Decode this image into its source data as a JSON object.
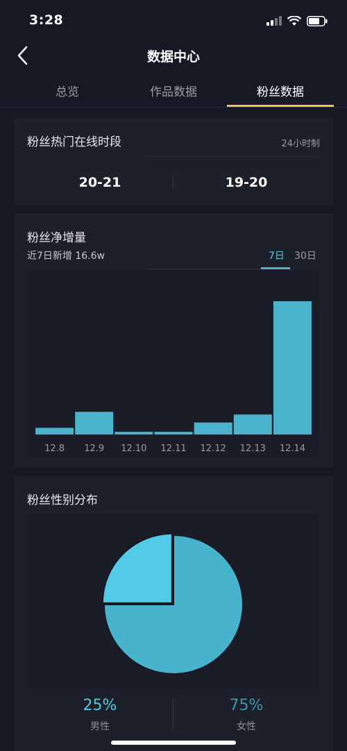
{
  "status": {
    "time": "3:28"
  },
  "nav": {
    "title": "数据中心"
  },
  "tabs": [
    {
      "label": "总览"
    },
    {
      "label": "作品数据"
    },
    {
      "label": "粉丝数据"
    }
  ],
  "active_tab": "粉丝数据",
  "online": {
    "title": "粉丝热门在线时段",
    "hint": "24小时制",
    "slots": [
      "20-21",
      "19-20"
    ]
  },
  "growth": {
    "title": "粉丝净增量",
    "subtitle": "近7日新增 16.6w",
    "ranges": [
      "7日",
      "30日"
    ],
    "active_range": "7日"
  },
  "gender": {
    "title": "粉丝性别分布",
    "male_pct": "25%",
    "male_label": "男性",
    "female_pct": "75%",
    "female_label": "女性"
  },
  "colors": {
    "bar": "#4ab4cf",
    "accent": "#55c8e0",
    "tab_indicator": "#f1c24c",
    "pie_female": "#47b3cd",
    "pie_male": "#52cbe6"
  },
  "chart_data": [
    {
      "type": "bar",
      "categories": [
        "12.8",
        "12.9",
        "12.10",
        "12.11",
        "12.12",
        "12.13",
        "12.14"
      ],
      "values": [
        5,
        17,
        2,
        2,
        9,
        15,
        100
      ],
      "ylim": [
        0,
        100
      ],
      "grid": false
    },
    {
      "type": "pie",
      "categories": [
        "男性",
        "女性"
      ],
      "values": [
        25,
        75
      ]
    }
  ]
}
